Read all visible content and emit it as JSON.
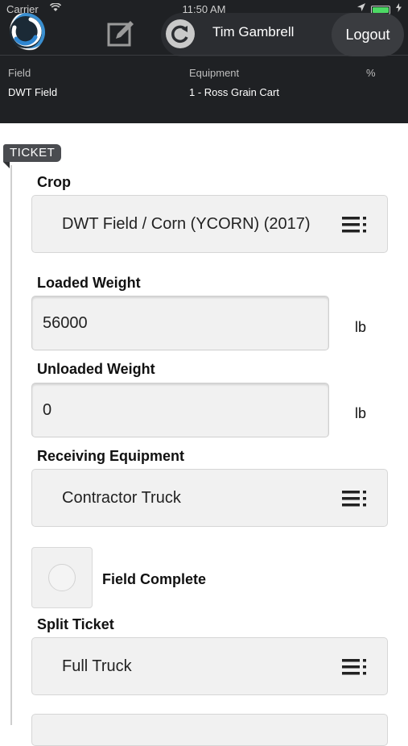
{
  "status_bar": {
    "carrier": "Carrier",
    "time": "11:50 AM",
    "wifi_icon": "wifi-icon",
    "location_icon": "location-arrow-icon",
    "battery_level": 1.0,
    "battery_color": "#4cd964"
  },
  "header": {
    "user_name": "Tim Gambrell",
    "logout_label": "Logout",
    "edit_icon": "edit-icon",
    "sync_icon": "sync-icon"
  },
  "info": {
    "field_label": "Field",
    "field_value": "DWT Field",
    "equipment_label": "Equipment",
    "equipment_value": "1 - Ross Grain Cart",
    "percent_label": "%"
  },
  "ticket": {
    "tag": "TICKET",
    "crop_label": "Crop",
    "crop_value": "DWT Field / Corn (YCORN) (2017)",
    "loaded_weight_label": "Loaded Weight",
    "loaded_weight_value": "56000",
    "loaded_weight_unit": "lb",
    "unloaded_weight_label": "Unloaded Weight",
    "unloaded_weight_value": "0",
    "unloaded_weight_unit": "lb",
    "receiving_equipment_label": "Receiving Equipment",
    "receiving_equipment_value": "Contractor Truck",
    "field_complete_label": "Field Complete",
    "field_complete_checked": false,
    "split_ticket_label": "Split Ticket",
    "split_ticket_value": "Full Truck"
  },
  "colors": {
    "header_bg": "#1f2124",
    "field_bg": "#f1f1f1",
    "tag_bg": "#4a4c50"
  }
}
